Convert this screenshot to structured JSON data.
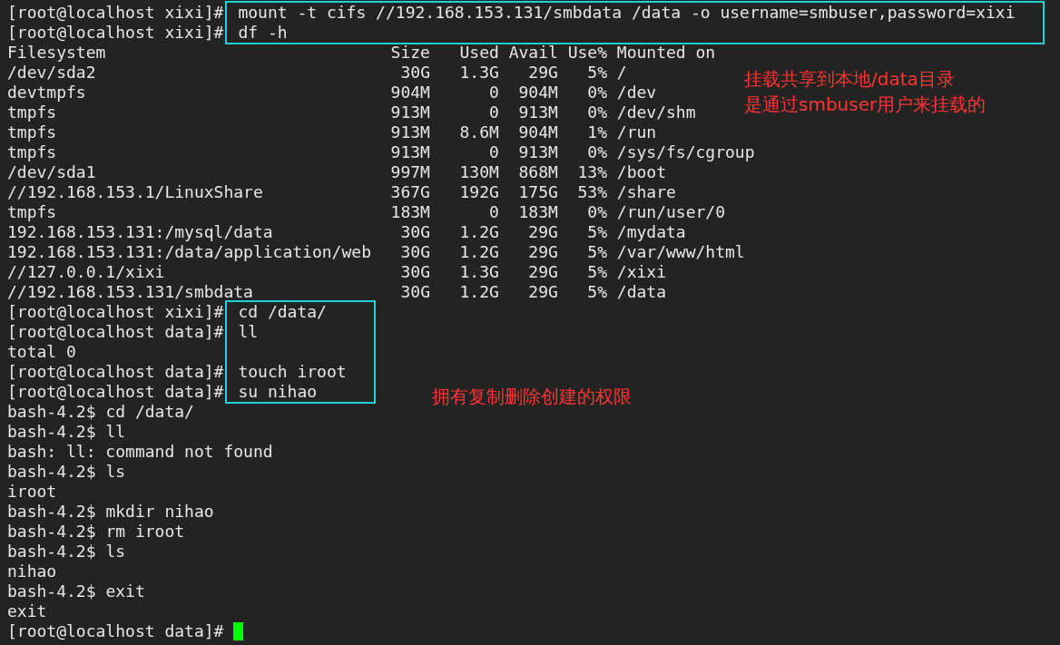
{
  "terminal": {
    "lines": [
      {
        "kind": "prompt",
        "prompt": "[root@localhost xixi]#",
        "command": "mount -t cifs //192.168.153.131/smbdata /data -o username=smbuser,password=xixi",
        "boxed": true
      },
      {
        "kind": "prompt",
        "prompt": "[root@localhost xixi]#",
        "command": "df -h",
        "boxed": true
      },
      {
        "kind": "table",
        "columns": [
          "Filesystem",
          "Size",
          "Used",
          "Avail",
          "Use%",
          "Mounted on"
        ],
        "note": [
          "挂载共享到本地/data目录",
          "是通过smbuser用户来挂载的"
        ],
        "rows": [
          [
            "/dev/sda2",
            "30G",
            "1.3G",
            "29G",
            "5%",
            "/"
          ],
          [
            "devtmpfs",
            "904M",
            "0",
            "904M",
            "0%",
            "/dev"
          ],
          [
            "tmpfs",
            "913M",
            "0",
            "913M",
            "0%",
            "/dev/shm"
          ],
          [
            "tmpfs",
            "913M",
            "8.6M",
            "904M",
            "1%",
            "/run"
          ],
          [
            "tmpfs",
            "913M",
            "0",
            "913M",
            "0%",
            "/sys/fs/cgroup"
          ],
          [
            "/dev/sda1",
            "997M",
            "130M",
            "868M",
            "13%",
            "/boot"
          ],
          [
            "//192.168.153.1/LinuxShare",
            "367G",
            "192G",
            "175G",
            "53%",
            "/share"
          ],
          [
            "tmpfs",
            "183M",
            "0",
            "183M",
            "0%",
            "/run/user/0"
          ],
          [
            "192.168.153.131:/mysql/data",
            "30G",
            "1.2G",
            "29G",
            "5%",
            "/mydata"
          ],
          [
            "192.168.153.131:/data/application/web",
            "30G",
            "1.2G",
            "29G",
            "5%",
            "/var/www/html"
          ],
          [
            "//127.0.0.1/xixi",
            "30G",
            "1.3G",
            "29G",
            "5%",
            "/xixi"
          ],
          [
            "//192.168.153.131/smbdata",
            "30G",
            "1.2G",
            "29G",
            "5%",
            "/data"
          ]
        ]
      },
      {
        "kind": "prompt",
        "prompt": "[root@localhost xixi]#",
        "command": "cd /data/",
        "boxed": true
      },
      {
        "kind": "prompt",
        "prompt": "[root@localhost data]#",
        "command": "ll",
        "boxed": true
      },
      {
        "kind": "output",
        "text": "total 0",
        "boxed": true
      },
      {
        "kind": "prompt",
        "prompt": "[root@localhost data]#",
        "command": "touch iroot",
        "boxed": true
      },
      {
        "kind": "prompt",
        "prompt": "[root@localhost data]#",
        "command": "su nihao",
        "boxed": true,
        "note": [
          "拥有复制删除创建的权限"
        ]
      },
      {
        "kind": "prompt",
        "prompt": "bash-4.2$",
        "command": "cd /data/",
        "boxed": false
      },
      {
        "kind": "prompt",
        "prompt": "bash-4.2$",
        "command": "ll",
        "boxed": false
      },
      {
        "kind": "output",
        "text": "bash: ll: command not found",
        "boxed": false
      },
      {
        "kind": "prompt",
        "prompt": "bash-4.2$",
        "command": "ls",
        "boxed": false
      },
      {
        "kind": "output",
        "text": "iroot",
        "boxed": false
      },
      {
        "kind": "prompt",
        "prompt": "bash-4.2$",
        "command": "mkdir nihao",
        "boxed": false
      },
      {
        "kind": "prompt",
        "prompt": "bash-4.2$",
        "command": "rm iroot",
        "boxed": false
      },
      {
        "kind": "prompt",
        "prompt": "bash-4.2$",
        "command": "ls",
        "boxed": false
      },
      {
        "kind": "output",
        "text": "nihao",
        "boxed": false
      },
      {
        "kind": "prompt",
        "prompt": "bash-4.2$",
        "command": "exit",
        "boxed": false
      },
      {
        "kind": "output",
        "text": "exit",
        "boxed": false
      },
      {
        "kind": "prompt",
        "prompt": "[root@localhost data]#",
        "boxed": false,
        "cursor": true
      }
    ]
  }
}
